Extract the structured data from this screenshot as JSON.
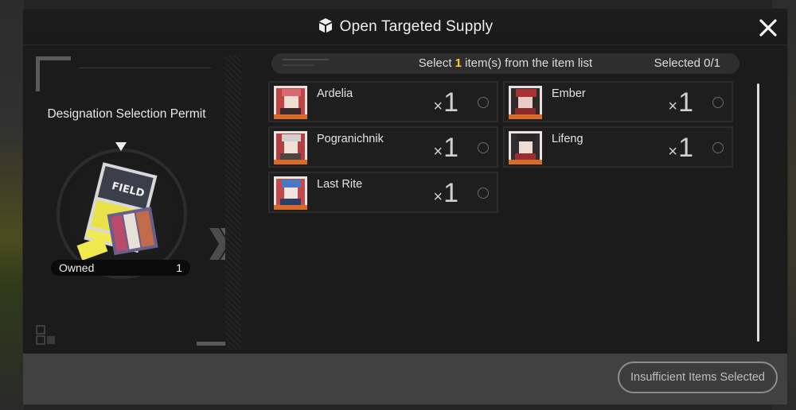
{
  "dialog": {
    "title": "Open Targeted Supply",
    "title_icon": "supply-box-icon",
    "close_icon": "close-icon"
  },
  "permit": {
    "name": "Designation Selection Permit",
    "owned_label": "Owned",
    "owned_count": "1"
  },
  "selection": {
    "prefix": "Select ",
    "count": "1",
    "suffix": " item(s) from the item list",
    "selected_status": "Selected 0/1",
    "highlight_color": "#f3d22a"
  },
  "items": [
    {
      "name": "Ardelia",
      "qty_prefix": "×",
      "qty": "1",
      "portrait_colors": [
        "#b33838",
        "#e6d0c8"
      ]
    },
    {
      "name": "Ember",
      "qty_prefix": "×",
      "qty": "1",
      "portrait_colors": [
        "#8c2a2a",
        "#d9a0a0"
      ]
    },
    {
      "name": "Pogranichnik",
      "qty_prefix": "×",
      "qty": "1",
      "portrait_colors": [
        "#9a3a3a",
        "#c8c0c0"
      ]
    },
    {
      "name": "Lifeng",
      "qty_prefix": "×",
      "qty": "1",
      "portrait_colors": [
        "#7a2e2e",
        "#e0e0e0"
      ]
    },
    {
      "name": "Last Rite",
      "qty_prefix": "×",
      "qty": "1",
      "portrait_colors": [
        "#3a5fa0",
        "#e8e8e8"
      ]
    }
  ],
  "footer": {
    "confirm_label": "Insufficient Items Selected"
  }
}
